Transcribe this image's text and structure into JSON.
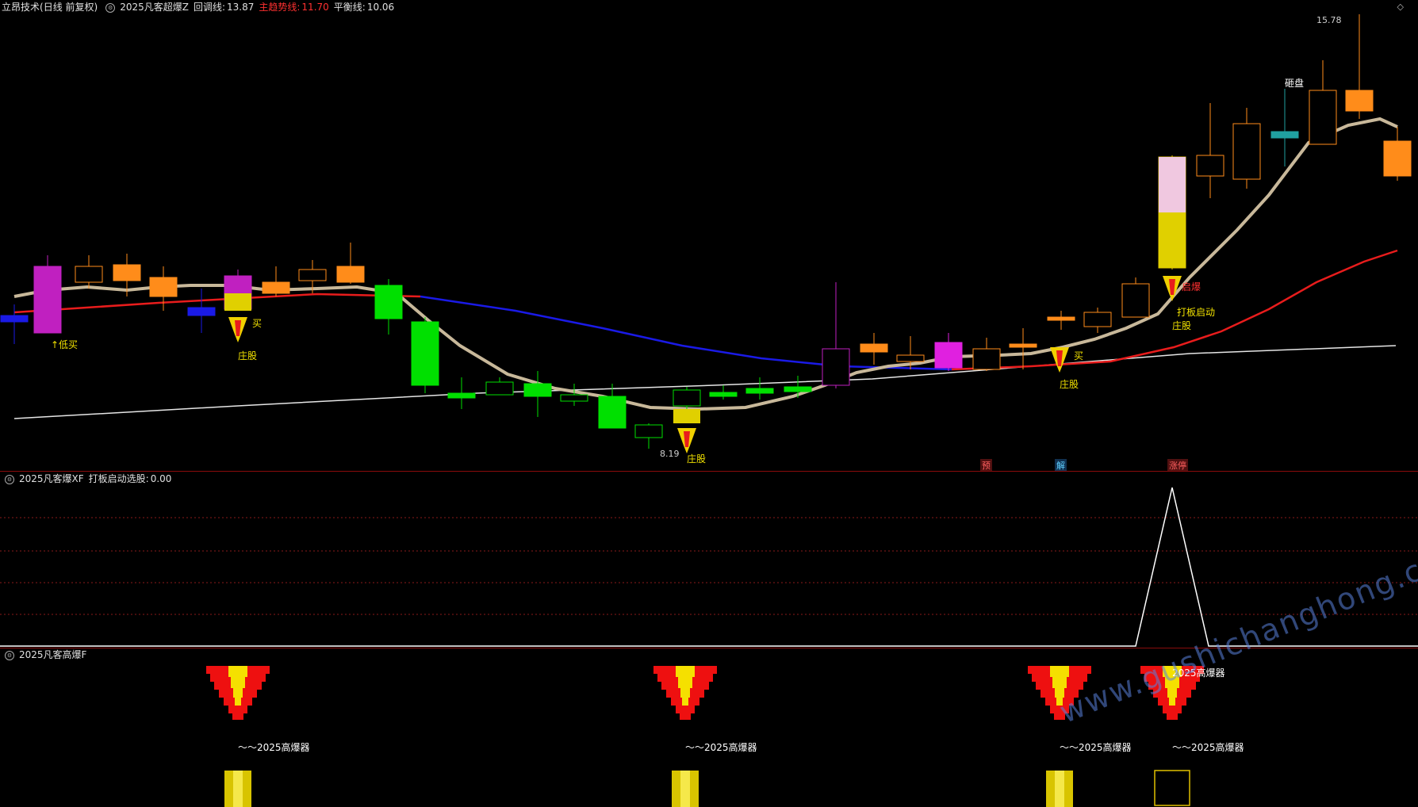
{
  "main_header": {
    "app": "立昂技术",
    "mode": "(日线 前复权)",
    "indicator": "2025凡客超爆Z",
    "pullback_label": "回调线:",
    "pullback_value": "13.87",
    "trend_label": "主趋势线:",
    "trend_value": "11.70",
    "balance_label": "平衡线:",
    "balance_value": "10.06"
  },
  "main_annotations": {
    "high_price": "15.78",
    "low_price": "8.19",
    "low_buy": "↑低买",
    "buy_1": "买",
    "buy_2": "买",
    "zhuanggu": "庄股",
    "zhuanggu_2": "庄股",
    "zhuanggu_3": "庄股",
    "zhuanggu_4": "庄股",
    "zhuanggu_5": "庄股",
    "zagpan": "砸盘",
    "qibao": "启爆",
    "daban": "打板启动",
    "badge_yu": "预",
    "badge_jie": "解",
    "badge_zhangting": "涨停"
  },
  "panel2_header": {
    "indicator": "2025凡客爆XF",
    "series_label": "打板启动选股:",
    "series_value": "0.00"
  },
  "panel3_header": {
    "indicator": "2025凡客高爆F"
  },
  "panel3_labels": {
    "label_a": "～～2025高爆器",
    "label_b": "～～2025高爆器",
    "label_c": "～～2025高爆器",
    "label_d": "～～2025高爆器",
    "label_top": "2025高爆器"
  },
  "watermark": "www.gushichanghong.com",
  "icons": {
    "gear": "gear-icon",
    "diamond": "diamond-icon"
  },
  "colors": {
    "up": "#ff8c1a",
    "down": "#00e000",
    "trend": "#e81c1c",
    "balance": "#e6e6e6",
    "pullback": "#c8b89a",
    "bluetrend": "#1a1ae6",
    "magenta": "#e020e0",
    "yellow": "#f0e000"
  }
}
